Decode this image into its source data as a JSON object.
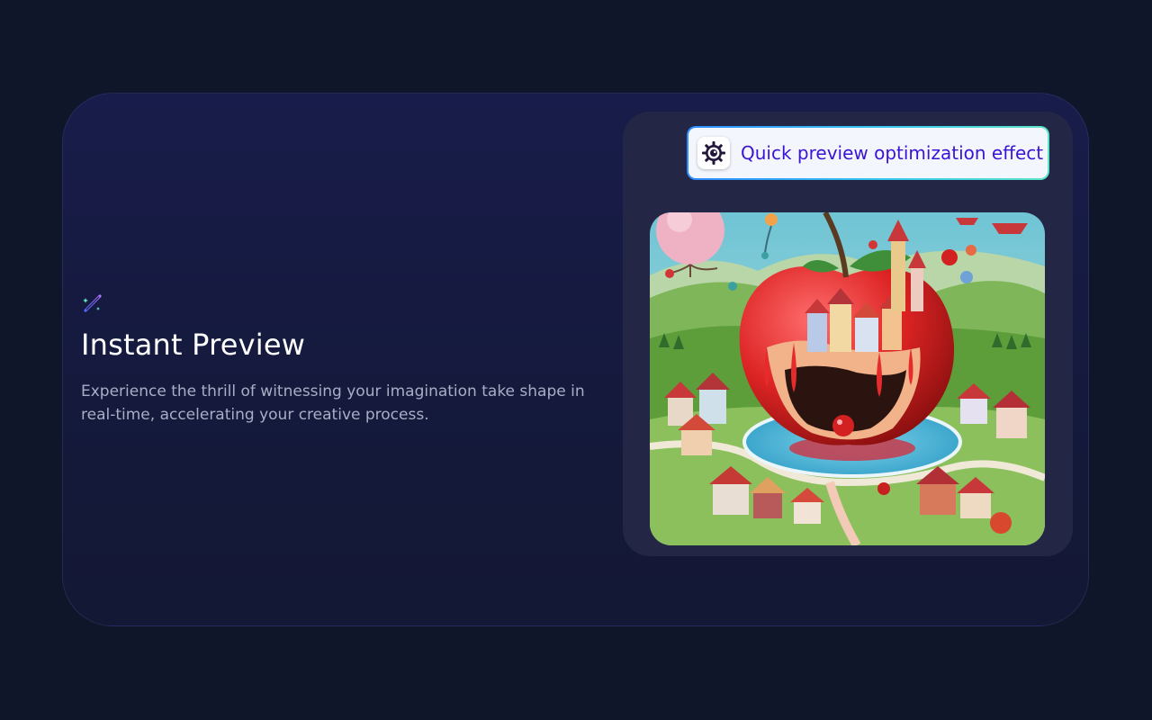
{
  "feature": {
    "icon": "magic-wand-icon",
    "title": "Instant Preview",
    "description": "Experience the thrill of witnessing your imagination take shape in real-time, accelerating your creative process."
  },
  "preview": {
    "badge_icon": "gear-eye-icon",
    "badge_label": "Quick preview optimization effect",
    "image": "surreal-apple-village-illustration"
  },
  "colors": {
    "page_bg": "#0f1629",
    "card_bg": "#181c4a",
    "panel_bg": "#232645",
    "badge_text": "#3a14d6",
    "badge_border_start": "#2e8bff",
    "badge_border_end": "#5ee6c8",
    "icon_accent": "#7b5cff"
  }
}
